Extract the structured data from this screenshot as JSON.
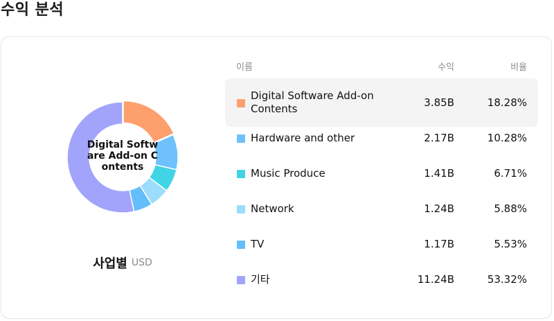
{
  "page": {
    "title": "수익 분석"
  },
  "summary": {
    "label": "사업별",
    "unit": "USD"
  },
  "table": {
    "headers": {
      "name": "이름",
      "revenue": "수익",
      "share": "비율"
    },
    "rows": [
      {
        "name": "Digital Software Add-on Contents",
        "revenue": "3.85B",
        "share": "18.28%",
        "color": "#FDA06E",
        "highlighted": true
      },
      {
        "name": "Hardware and other",
        "revenue": "2.17B",
        "share": "10.28%",
        "color": "#6EC1FC",
        "highlighted": false
      },
      {
        "name": "Music Produce",
        "revenue": "1.41B",
        "share": "6.71%",
        "color": "#40D4E6",
        "highlighted": false
      },
      {
        "name": "Network",
        "revenue": "1.24B",
        "share": "5.88%",
        "color": "#9BDDFB",
        "highlighted": false
      },
      {
        "name": "TV",
        "revenue": "1.17B",
        "share": "5.53%",
        "color": "#64BEFA",
        "highlighted": false
      },
      {
        "name": "기타",
        "revenue": "11.24B",
        "share": "53.32%",
        "color": "#A2A3FB",
        "highlighted": false
      }
    ]
  },
  "chart_data": {
    "type": "pie",
    "variant": "donut",
    "center_label": "Digital Software Add-on Contents",
    "categories": [
      "Digital Software Add-on Contents",
      "Hardware and other",
      "Music Produce",
      "Network",
      "TV",
      "기타"
    ],
    "values": [
      18.28,
      10.28,
      6.71,
      5.88,
      5.53,
      53.32
    ],
    "unit": "%",
    "colors": [
      "#FDA06E",
      "#6EC1FC",
      "#40D4E6",
      "#9BDDFB",
      "#64BEFA",
      "#A2A3FB"
    ],
    "exploded_index": 0
  }
}
